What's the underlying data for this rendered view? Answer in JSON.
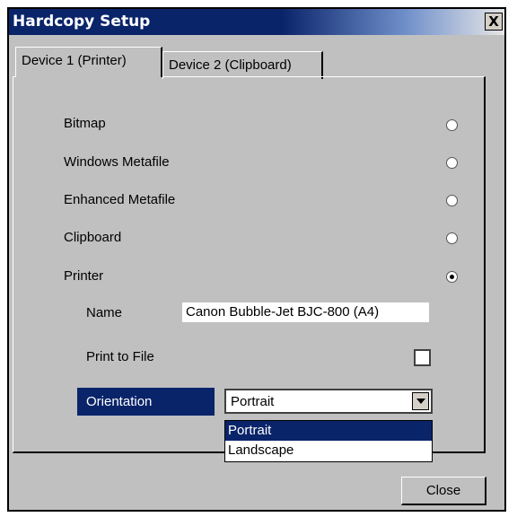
{
  "window": {
    "title": "Hardcopy Setup",
    "close_glyph": "X"
  },
  "tabs": [
    {
      "label": "Device 1 (Printer)",
      "active": true
    },
    {
      "label": "Device 2 (Clipboard)",
      "active": false
    }
  ],
  "options": [
    {
      "label": "Bitmap",
      "selected": false
    },
    {
      "label": "Windows Metafile",
      "selected": false
    },
    {
      "label": "Enhanced Metafile",
      "selected": false
    },
    {
      "label": "Clipboard",
      "selected": false
    },
    {
      "label": "Printer",
      "selected": true
    }
  ],
  "printer": {
    "name_label": "Name",
    "name_value": "Canon Bubble-Jet BJC-800 (A4)",
    "print_to_file_label": "Print to File",
    "print_to_file_checked": false,
    "orientation_label": "Orientation",
    "orientation_value": "Portrait",
    "orientation_options": [
      "Portrait",
      "Landscape"
    ]
  },
  "buttons": {
    "close": "Close"
  },
  "colors": {
    "title_bar": "#0a246a",
    "dialog_bg": "#c0c0c0",
    "selection": "#0a246a"
  },
  "icons": {
    "close": "close-icon",
    "dropdown": "chevron-down-icon",
    "radio": "radio-icon"
  }
}
